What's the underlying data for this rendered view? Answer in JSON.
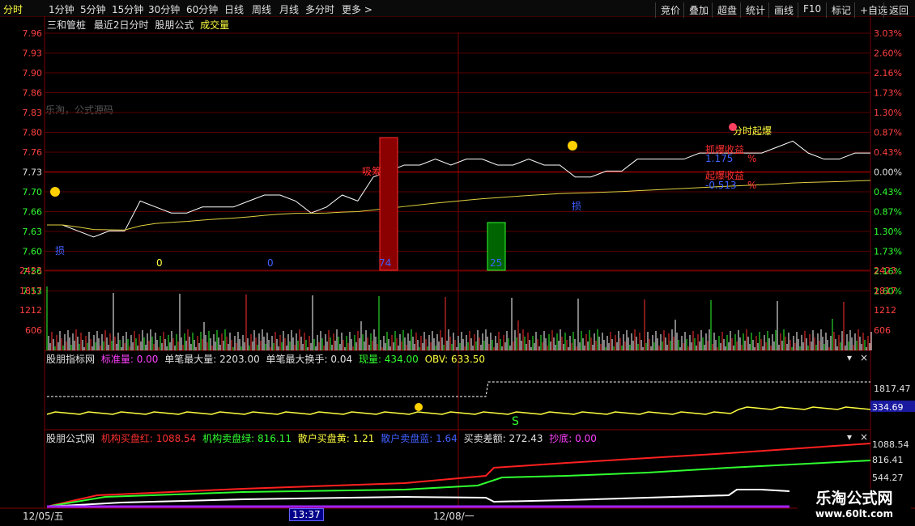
{
  "toolbar": {
    "periods": [
      "分时",
      "1分钟",
      "5分钟",
      "15分钟",
      "30分钟",
      "60分钟",
      "日线",
      "周线",
      "月线",
      "多分时",
      "更多 >"
    ],
    "right_buttons": [
      "竞价",
      "叠加",
      "超盘",
      "统计",
      "画线",
      "F10",
      "标记",
      "+自选",
      "返回"
    ]
  },
  "header": {
    "stock": "三和管桩",
    "mode": "最近2日分时",
    "formula": "股朋公式",
    "volume_label": "成交量"
  },
  "watermark": "乐淘，公式源码",
  "price_axis": {
    "left": [
      "7.96",
      "7.93",
      "7.90",
      "7.86",
      "7.83",
      "7.80",
      "7.76",
      "7.73",
      "7.70",
      "7.66",
      "7.63",
      "7.60",
      "7.56",
      "7.53"
    ],
    "right": [
      "3.03%",
      "2.60%",
      "2.16%",
      "1.73%",
      "1.30%",
      "0.87%",
      "0.43%",
      "0.00%",
      "0.43%",
      "0.87%",
      "1.30%",
      "1.73%",
      "2.16%",
      "2.60%"
    ]
  },
  "volume_axis": [
    "2423",
    "1817",
    "1212",
    "606"
  ],
  "annotations": {
    "zero1": "0",
    "zero2": "0",
    "red_bar_value": "74",
    "green_bar_value": "25",
    "xiji": "吸筹",
    "fenshi_qibao": "分时起爆",
    "zhuabao": "抓爆收益",
    "zhuabao_val": "1.175",
    "qibao": "起爆收益",
    "qibao_val": "-0.513",
    "pct1": "%",
    "pct2": "%",
    "mark_left": "损",
    "mark_mid": "损",
    "s_mark": "S"
  },
  "panel1": {
    "title": "股朋指标网",
    "items": [
      {
        "label": "标准量:",
        "value": "0.00",
        "color": "#ff40ff"
      },
      {
        "label": "单笔最大量:",
        "value": "2203.00",
        "color": "#e0e0e0"
      },
      {
        "label": "单笔最大换手:",
        "value": "0.04",
        "color": "#e0e0e0"
      },
      {
        "label": "现量:",
        "value": "434.00",
        "color": "#30ff30"
      },
      {
        "label": "OBV:",
        "value": "633.50",
        "color": "#ffff40"
      }
    ],
    "axis_value": "1817.47",
    "current_value": "334.69"
  },
  "panel2": {
    "title": "股朋公式网",
    "items": [
      {
        "label": "机构买盘红:",
        "value": "1088.54",
        "color": "#ff3030"
      },
      {
        "label": "机构卖盘绿:",
        "value": "816.11",
        "color": "#30ff30"
      },
      {
        "label": "散户买盘黄:",
        "value": "1.21",
        "color": "#ffff40"
      },
      {
        "label": "散户卖盘蓝:",
        "value": "1.64",
        "color": "#4060ff"
      },
      {
        "label": "买卖差额:",
        "value": "272.43",
        "color": "#e0e0e0"
      },
      {
        "label": "抄底:",
        "value": "0.00",
        "color": "#ff40ff"
      }
    ],
    "axis": [
      "1088.54",
      "816.41",
      "544.27"
    ]
  },
  "time_axis": {
    "left": "12/05/五",
    "cursor": "13:37",
    "mid": "12/08/一"
  },
  "brand": {
    "name": "乐淘公式网",
    "url": "www.60lt.com"
  },
  "chart_data": {
    "type": "line",
    "title": "三和管桩 最近2日分时",
    "price_range": [
      7.51,
      7.98
    ],
    "prev_close": 7.73,
    "price_series": [
      7.64,
      7.64,
      7.63,
      7.62,
      7.63,
      7.63,
      7.68,
      7.67,
      7.66,
      7.66,
      7.67,
      7.67,
      7.67,
      7.68,
      7.69,
      7.69,
      7.68,
      7.66,
      7.67,
      7.69,
      7.68,
      7.72,
      7.73,
      7.74,
      7.74,
      7.75,
      7.74,
      7.75,
      7.75,
      7.74,
      7.74,
      7.75,
      7.74,
      7.74,
      7.72,
      7.72,
      7.73,
      7.73,
      7.75,
      7.75,
      7.75,
      7.75,
      7.76,
      7.76,
      7.76,
      7.76,
      7.76,
      7.77,
      7.78,
      7.76,
      7.75,
      7.75,
      7.76,
      7.76
    ],
    "avg_series_note": "yellow average line",
    "signal_bars": [
      {
        "x_index": 22,
        "value": 74,
        "color": "red"
      },
      {
        "x_index": 28,
        "value": 25,
        "color": "green"
      }
    ]
  }
}
